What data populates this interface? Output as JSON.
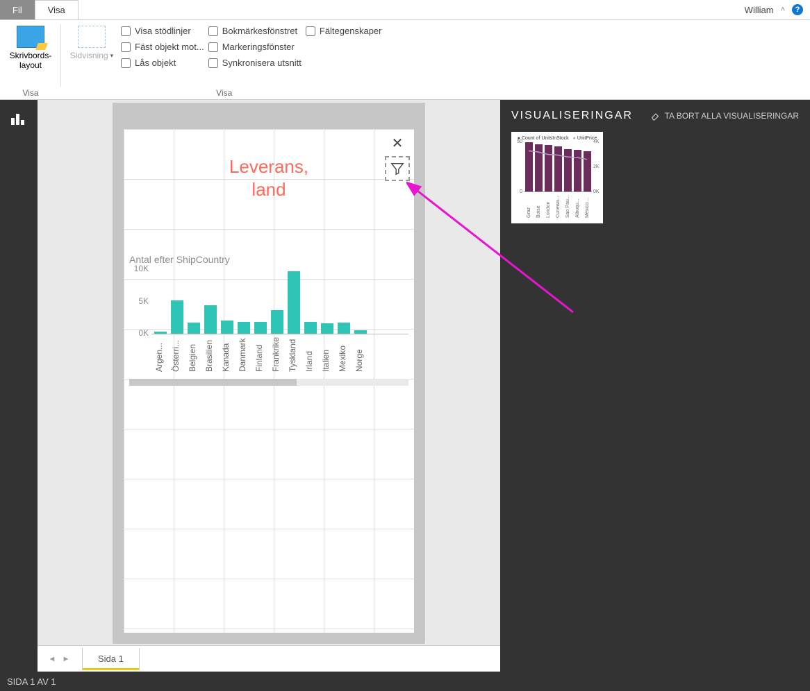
{
  "titlebar": {
    "fil": "Fil",
    "visa": "Visa",
    "user": "William"
  },
  "ribbon": {
    "skrivbord": "Skrivbords-\nlayout",
    "sidvisning": "Sidvisning",
    "visa_group": "Visa",
    "checks1": [
      "Visa stödlinjer",
      "Fäst objekt mot...",
      "Lås objekt"
    ],
    "checks2": [
      "Bokmärkesfönstret",
      "Markeringsfönster",
      "Synkronisera utsnitt"
    ],
    "checks3": [
      "Fältegenskaper"
    ],
    "visa_group2": "Visa"
  },
  "visual": {
    "title_line1": "Leverans,",
    "title_line2": "land"
  },
  "chart_data": {
    "type": "bar",
    "title": "Antal efter ShipCountry",
    "ylabel": "",
    "ylim": [
      0,
      10000
    ],
    "yticks": [
      "10K",
      "5K",
      "0K"
    ],
    "categories": [
      "Argen...",
      "Österri...",
      "Belgien",
      "Brasilien",
      "Kanada",
      "Danmark",
      "Finland",
      "Frankrike",
      "Tyskland",
      "Irland",
      "Italien",
      "Mexiko",
      "Norge"
    ],
    "values": [
      300,
      5100,
      1700,
      4300,
      2000,
      1800,
      1800,
      3600,
      9500,
      1800,
      1600,
      1700,
      500
    ]
  },
  "thumbnail_chart": {
    "legend": [
      "Count of UnitsInStock",
      "UnitPrice"
    ],
    "yleft": [
      "50",
      "0"
    ],
    "yright": [
      "4K",
      "2K",
      "0K"
    ],
    "categories": [
      "Graz",
      "Boise",
      "London",
      "Cunewa...",
      "Sao Pau...",
      "Albuqu...",
      "México ..."
    ],
    "bar_values": [
      50,
      48,
      47,
      46,
      43,
      42,
      41
    ],
    "line_values": [
      3300,
      3200,
      3000,
      2950,
      2800,
      2750,
      2600
    ]
  },
  "vis_panel": {
    "title": "VISUALISERINGAR",
    "remove": "TA BORT ALLA VISUALISERINGAR"
  },
  "page_tab": "Sida 1",
  "status": "SIDA 1 AV 1"
}
